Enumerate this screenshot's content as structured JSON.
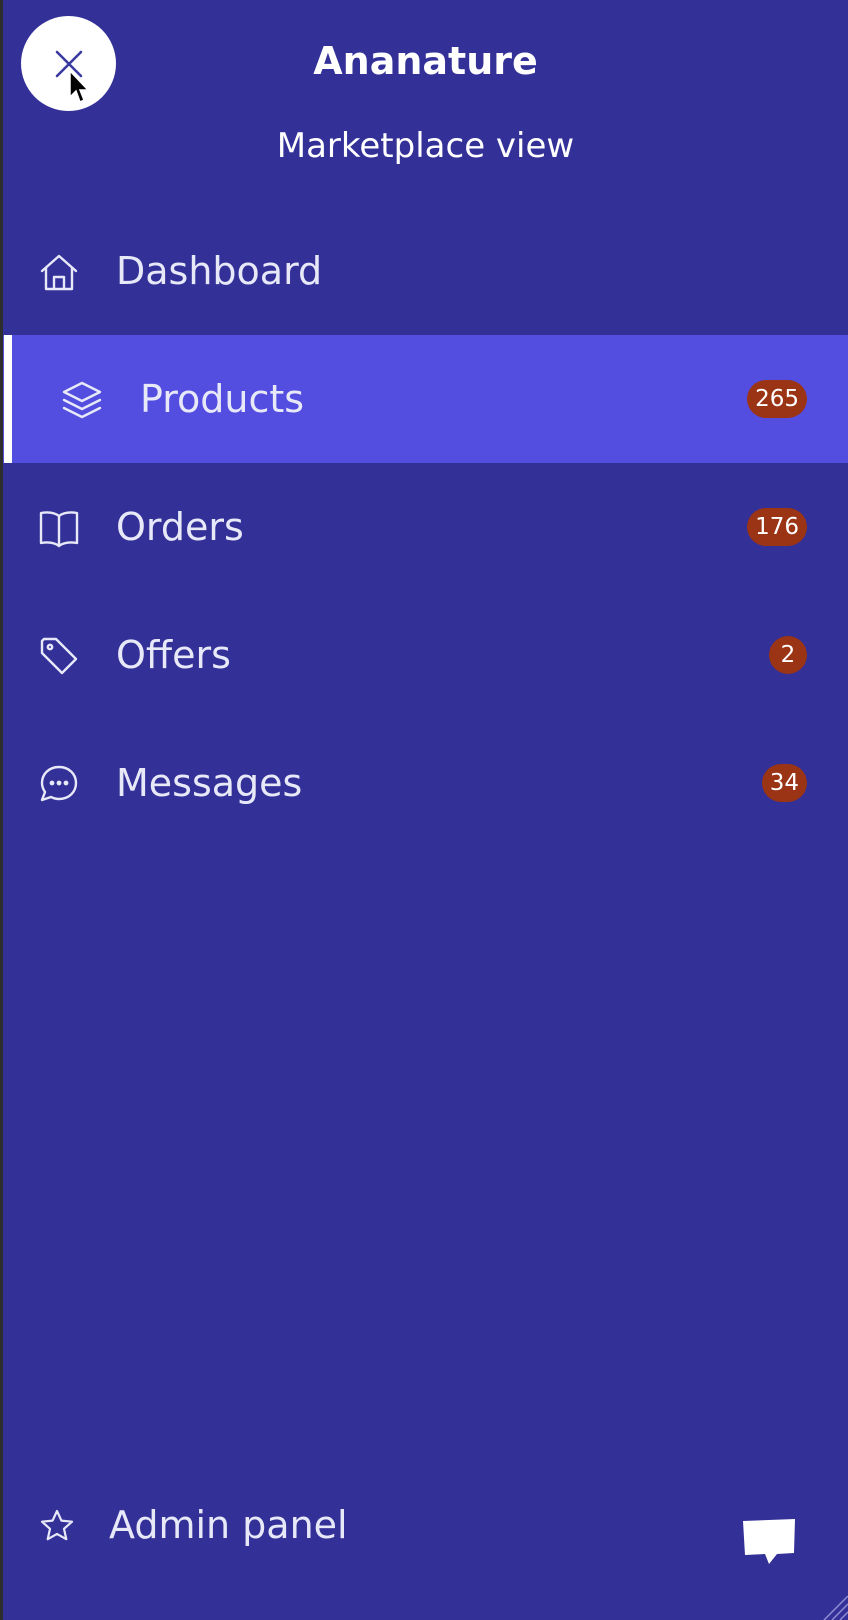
{
  "header": {
    "brand": "Ananature",
    "subtitle": "Marketplace view"
  },
  "nav": {
    "items": [
      {
        "label": "Dashboard",
        "icon": "home-icon",
        "badge": null
      },
      {
        "label": "Products",
        "icon": "layers-icon",
        "badge": "265",
        "active": true
      },
      {
        "label": "Orders",
        "icon": "book-open-icon",
        "badge": "176"
      },
      {
        "label": "Offers",
        "icon": "tag-icon",
        "badge": "2"
      },
      {
        "label": "Messages",
        "icon": "chat-bubble-icon",
        "badge": "34"
      }
    ]
  },
  "footer": {
    "admin_label": "Admin panel",
    "admin_icon": "star-icon",
    "chat_icon": "speech-bubble-icon"
  },
  "colors": {
    "drawer_bg": "#333098",
    "active_bg": "#534de0",
    "badge_bg": "#9a3414",
    "text": "#e8e9f8"
  }
}
